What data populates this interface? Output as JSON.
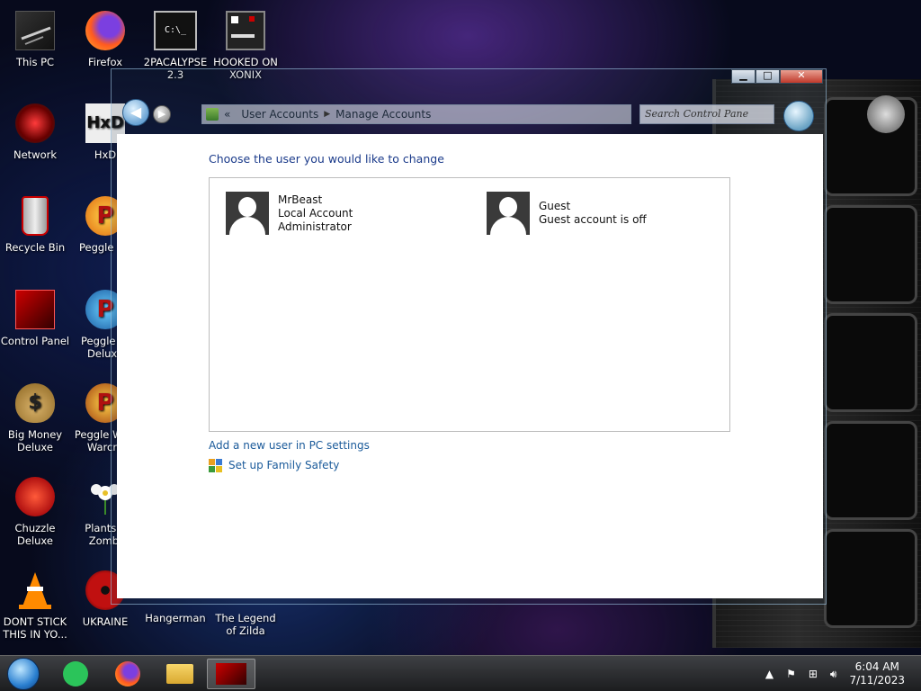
{
  "desktop": {
    "icons": [
      {
        "label": "This PC",
        "x": 0,
        "y": 0
      },
      {
        "label": "Firefox"
      },
      {
        "label": "2PACALYPSE 2.3"
      },
      {
        "label": "HOOKED ON XONIX"
      },
      {
        "label": "Network"
      },
      {
        "label": "HxD"
      },
      {
        "label": "Recycle Bin"
      },
      {
        "label": "Peggle De"
      },
      {
        "label": "Control Panel"
      },
      {
        "label": "Peggle Ni Deluxe"
      },
      {
        "label": "Big Money Deluxe"
      },
      {
        "label": "Peggle W of Warcra"
      },
      {
        "label": "Chuzzle Deluxe"
      },
      {
        "label": "Plants v Zombi"
      },
      {
        "label": "DONT STICK THIS IN YO..."
      },
      {
        "label": "UKRAINE"
      },
      {
        "label": "Hangerman"
      },
      {
        "label": "The Legend of Zilda"
      }
    ]
  },
  "window": {
    "caption_buttons": {
      "minimize": "▁",
      "maximize": "□",
      "close": "✕"
    },
    "nav": {
      "back_icon": "arrow-left-icon",
      "forward_icon": "arrow-right-icon"
    },
    "breadcrumb": {
      "prefix": "«",
      "items": [
        "User Accounts",
        "Manage Accounts"
      ]
    },
    "search": {
      "placeholder": "Search Control Pane"
    },
    "heading": "Choose the user you would like to change",
    "users": [
      {
        "name": "MrBeast",
        "line2": "Local Account",
        "line3": "Administrator"
      },
      {
        "name": "Guest",
        "line2": "Guest account is off",
        "line3": ""
      }
    ],
    "links": {
      "add_user": "Add a new user in PC settings",
      "family_safety": "Set up Family Safety"
    }
  },
  "taskbar": {
    "clock_time": "6:04 AM",
    "clock_date": "7/11/2023",
    "tray_icons": [
      "chevron-up-icon",
      "flag-icon",
      "network-icon",
      "volume-icon"
    ]
  }
}
